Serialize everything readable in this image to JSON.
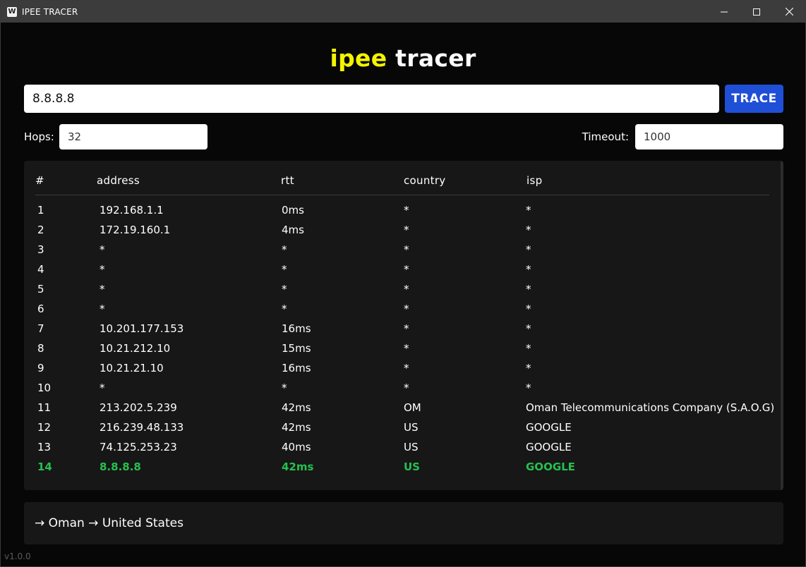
{
  "window": {
    "title": "IPEE TRACER",
    "icon_letter": "W"
  },
  "logo": {
    "part1": "ipee",
    "part2": " tracer",
    "accent_color": "#f4f400"
  },
  "search": {
    "value": "8.8.8.8",
    "button_label": "TRACE",
    "button_color": "#1f4fd6"
  },
  "options": {
    "hops_label": "Hops:",
    "hops_value": "32",
    "timeout_label": "Timeout:",
    "timeout_value": "1000"
  },
  "table": {
    "headers": [
      "#",
      "address",
      "rtt",
      "country",
      "isp"
    ],
    "rows": [
      {
        "num": "1",
        "address": "192.168.1.1",
        "rtt": "0ms",
        "country": "*",
        "isp": "*"
      },
      {
        "num": "2",
        "address": "172.19.160.1",
        "rtt": "4ms",
        "country": "*",
        "isp": "*"
      },
      {
        "num": "3",
        "address": "*",
        "rtt": "*",
        "country": "*",
        "isp": "*"
      },
      {
        "num": "4",
        "address": "*",
        "rtt": "*",
        "country": "*",
        "isp": "*"
      },
      {
        "num": "5",
        "address": "*",
        "rtt": "*",
        "country": "*",
        "isp": "*"
      },
      {
        "num": "6",
        "address": "*",
        "rtt": "*",
        "country": "*",
        "isp": "*"
      },
      {
        "num": "7",
        "address": "10.201.177.153",
        "rtt": "16ms",
        "country": "*",
        "isp": "*"
      },
      {
        "num": "8",
        "address": "10.21.212.10",
        "rtt": "15ms",
        "country": "*",
        "isp": "*"
      },
      {
        "num": "9",
        "address": "10.21.21.10",
        "rtt": "16ms",
        "country": "*",
        "isp": "*"
      },
      {
        "num": "10",
        "address": "*",
        "rtt": "*",
        "country": "*",
        "isp": "*"
      },
      {
        "num": "11",
        "address": "213.202.5.239",
        "rtt": "42ms",
        "country": "OM",
        "isp": "Oman Telecommunications Company (S.A.O.G)"
      },
      {
        "num": "12",
        "address": "216.239.48.133",
        "rtt": "42ms",
        "country": "US",
        "isp": "GOOGLE"
      },
      {
        "num": "13",
        "address": "74.125.253.23",
        "rtt": "40ms",
        "country": "US",
        "isp": "GOOGLE"
      },
      {
        "num": "14",
        "address": "8.8.8.8",
        "rtt": "42ms",
        "country": "US",
        "isp": "GOOGLE"
      }
    ],
    "final_row_color": "#25c14f"
  },
  "route": {
    "text": "→ Oman → United States"
  },
  "version": "v1.0.0"
}
